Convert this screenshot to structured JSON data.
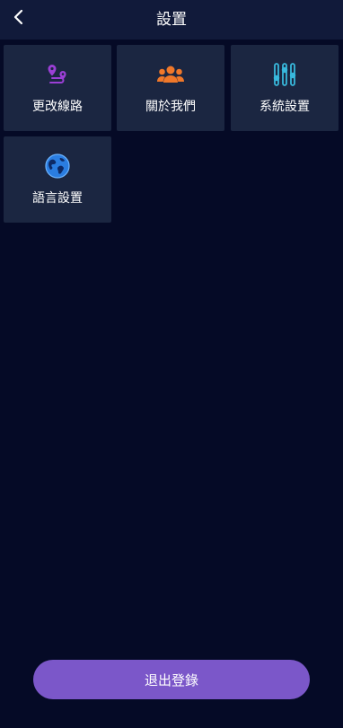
{
  "header": {
    "title": "設置",
    "back_icon": "chevron-left-icon"
  },
  "tiles": [
    {
      "label": "更改線路",
      "icon": "route-pin-icon",
      "icon_color": "#9b3fd6"
    },
    {
      "label": "關於我們",
      "icon": "group-icon",
      "icon_color": "#f0782a"
    },
    {
      "label": "系統設置",
      "icon": "sliders-icon",
      "icon_color": "#38b8dc"
    },
    {
      "label": "語言設置",
      "icon": "globe-icon",
      "icon_color": "#2a7de1"
    }
  ],
  "logout": {
    "label": "退出登錄",
    "color": "#7b57c9"
  },
  "colors": {
    "background": "#050a26",
    "header": "#111a3a",
    "tile": "#1b2641"
  }
}
